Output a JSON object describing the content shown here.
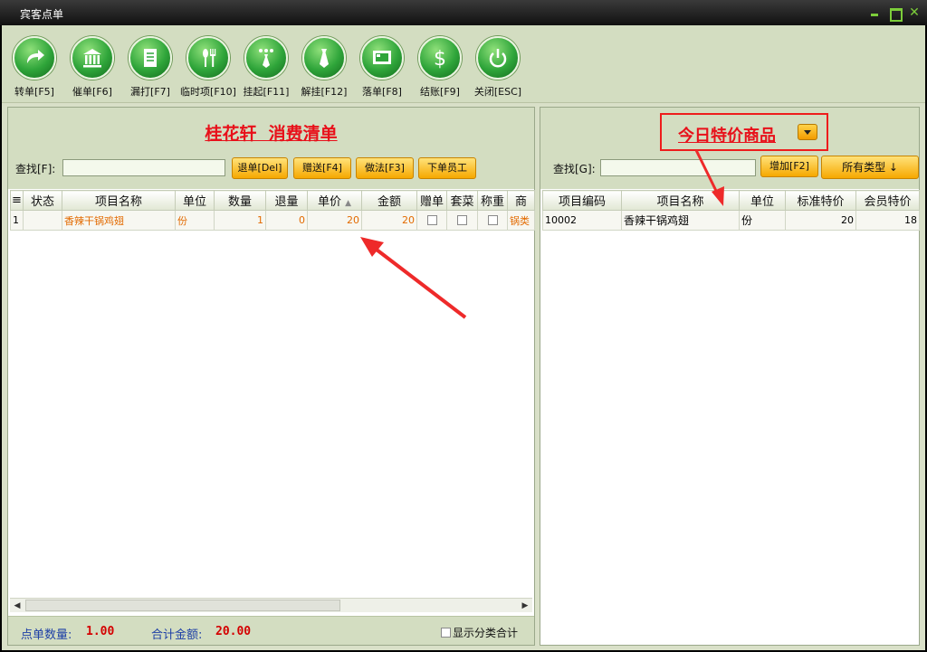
{
  "window": {
    "title": "宾客点单"
  },
  "toolbar": {
    "items": [
      {
        "label": "转单[F5]",
        "icon": "transfer-icon"
      },
      {
        "label": "催单[F6]",
        "icon": "bank-icon"
      },
      {
        "label": "漏打[F7]",
        "icon": "document-icon"
      },
      {
        "label": "临时项[F10]",
        "icon": "spoon-fork-icon"
      },
      {
        "label": "挂起[F11]",
        "icon": "tie-dots-icon"
      },
      {
        "label": "解挂[F12]",
        "icon": "tie-icon"
      },
      {
        "label": "落单[F8]",
        "icon": "screen-icon"
      },
      {
        "label": "结账[F9]",
        "icon": "dollar-icon"
      },
      {
        "label": "关闭[ESC]",
        "icon": "power-icon"
      }
    ]
  },
  "left": {
    "title": "桂花轩  消费清单",
    "search_label": "查找[F]:",
    "search_value": "",
    "buttons": {
      "return": "退单[Del]",
      "gift": "赠送[F4]",
      "method": "做法[F3]",
      "staff": "下单员工"
    },
    "columns": [
      "≡",
      "状态",
      "项目名称",
      "单位",
      "数量",
      "退量",
      "单价",
      "金额",
      "赠单",
      "套菜",
      "称重",
      "商"
    ],
    "rows": [
      {
        "idx": "1",
        "status": "",
        "name": "香辣干锅鸡翅",
        "unit": "份",
        "qty": "1",
        "ret": "0",
        "price": "20",
        "amount": "20",
        "category": "锅类"
      }
    ],
    "footer": {
      "count_label": "点单数量:",
      "count_value": "1.00",
      "total_label": "合计金额:",
      "total_value": "20.00",
      "show_category_total": "显示分类合计"
    }
  },
  "right": {
    "title": "今日特价商品",
    "search_label": "查找[G]:",
    "search_value": "",
    "add_button": "增加[F2]",
    "type_button": "所有类型 ↓",
    "columns": [
      "项目编码",
      "项目名称",
      "单位",
      "标准特价",
      "会员特价"
    ],
    "rows": [
      {
        "code": "10002",
        "name": "香辣干锅鸡翅",
        "unit": "份",
        "std_price": "20",
        "member_price": "18"
      }
    ]
  },
  "colors": {
    "accent_red": "#e8101a",
    "button_orange": "#f6a800",
    "panel_green": "#d3ddc1",
    "label_blue": "#1d3fa6"
  }
}
